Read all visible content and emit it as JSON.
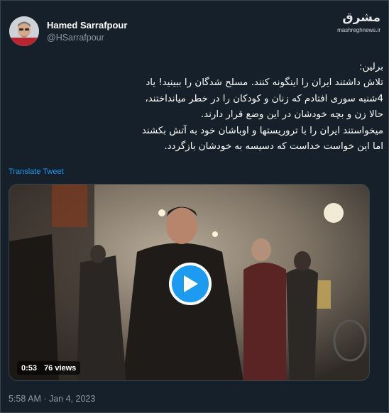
{
  "author": {
    "name": "Hamed Sarrafpour",
    "handle": "@HSarrafpour",
    "avatar_icon": "user-avatar-icon"
  },
  "watermark": {
    "logo_text": "مشرق",
    "url": "mashreghnews.ir"
  },
  "tweet": {
    "lines": [
      "برلین:",
      "تلاش داشتند ایران را اینگونه کنند. مسلح شدگان را ببینید! یاد",
      "4شنبه سوری افتادم که زنان و کودکان را در خطر میانداختند،",
      "حالا زن و بچه خودشان در این وضع قرار دارند.",
      "میخواستند ایران را با تروریستها و اوباشان خود به آتش بکشند",
      "اما این خواست خداست که دسیسه به خودشان بازگردد."
    ],
    "translate_label": "Translate Tweet"
  },
  "video": {
    "duration": "0:53",
    "views": "76 views",
    "play_icon": "play-icon"
  },
  "timestamp": "5:58 AM · Jan 4, 2023",
  "colors": {
    "background": "#15202b",
    "accent": "#1d9bf0",
    "secondary_text": "#8b98a5",
    "border": "#38444d"
  }
}
